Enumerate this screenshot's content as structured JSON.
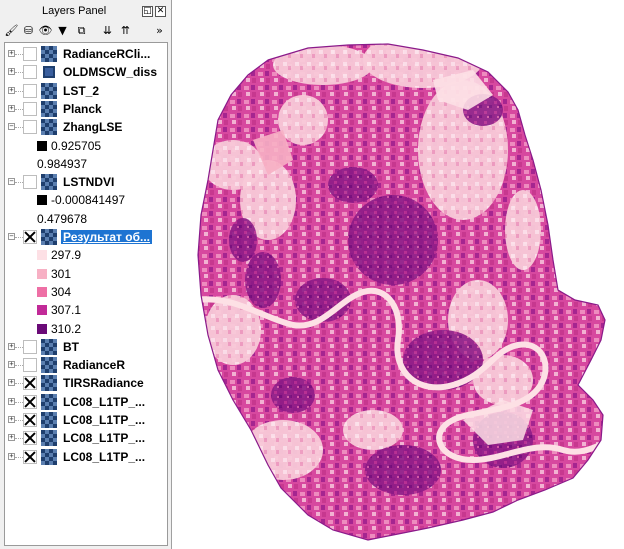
{
  "panel": {
    "title": "Layers Panel",
    "float_glyph": "◱",
    "close_glyph": "✕",
    "toolbar": [
      {
        "icon": "paint-brush-icon",
        "glyph": "🖌"
      },
      {
        "icon": "add-group-icon",
        "glyph": "⛁"
      },
      {
        "icon": "visibility-eye-icon",
        "glyph": "👁"
      },
      {
        "icon": "filter-icon",
        "glyph": "▼"
      },
      {
        "icon": "filter-legend-icon",
        "glyph": "⧉"
      },
      {
        "icon": "expand-all-icon",
        "glyph": "⇊"
      },
      {
        "icon": "collapse-all-icon",
        "glyph": "⇈"
      },
      {
        "icon": "more-icon",
        "glyph": "»"
      }
    ]
  },
  "layers": [
    {
      "name": "RadianceRCli...",
      "checked": false,
      "type": "raster"
    },
    {
      "name": "OLDMSCW_diss",
      "checked": false,
      "type": "vector"
    },
    {
      "name": "LST_2",
      "checked": false,
      "type": "raster"
    },
    {
      "name": "Planck",
      "checked": false,
      "type": "raster"
    },
    {
      "name": "ZhangLSE",
      "checked": false,
      "type": "raster",
      "legend": [
        {
          "label": "0.925705",
          "color": "#000000"
        },
        {
          "label": "0.984937",
          "color": null
        }
      ]
    },
    {
      "name": "LSTNDVI",
      "checked": false,
      "type": "raster",
      "legend": [
        {
          "label": "-0.000841497",
          "color": "#000000"
        },
        {
          "label": "0.479678",
          "color": null
        }
      ]
    },
    {
      "name": "Результат об...",
      "checked": true,
      "type": "raster",
      "selected": true,
      "legend": [
        {
          "label": "297.9",
          "color": "#fde0e5"
        },
        {
          "label": "301",
          "color": "#f7b0c4"
        },
        {
          "label": "304",
          "color": "#ee6fa5"
        },
        {
          "label": "307.1",
          "color": "#c12a98"
        },
        {
          "label": "310.2",
          "color": "#6a0a77"
        }
      ]
    },
    {
      "name": "BT",
      "checked": false,
      "type": "raster"
    },
    {
      "name": "RadianceR",
      "checked": false,
      "type": "raster"
    },
    {
      "name": "TIRSRadiance",
      "checked": true,
      "type": "raster"
    },
    {
      "name": "LC08_L1TP_...",
      "checked": true,
      "type": "raster"
    },
    {
      "name": "LC08_L1TP_...",
      "checked": true,
      "type": "raster"
    },
    {
      "name": "LC08_L1TP_...",
      "checked": true,
      "type": "raster"
    },
    {
      "name": "LC08_L1TP_...",
      "checked": true,
      "type": "raster"
    }
  ],
  "map": {
    "colors": {
      "low": "#fde0e5",
      "mid_low": "#f7b0c4",
      "mid": "#e06aa8",
      "high": "#b72c92",
      "top": "#7a117f"
    }
  }
}
